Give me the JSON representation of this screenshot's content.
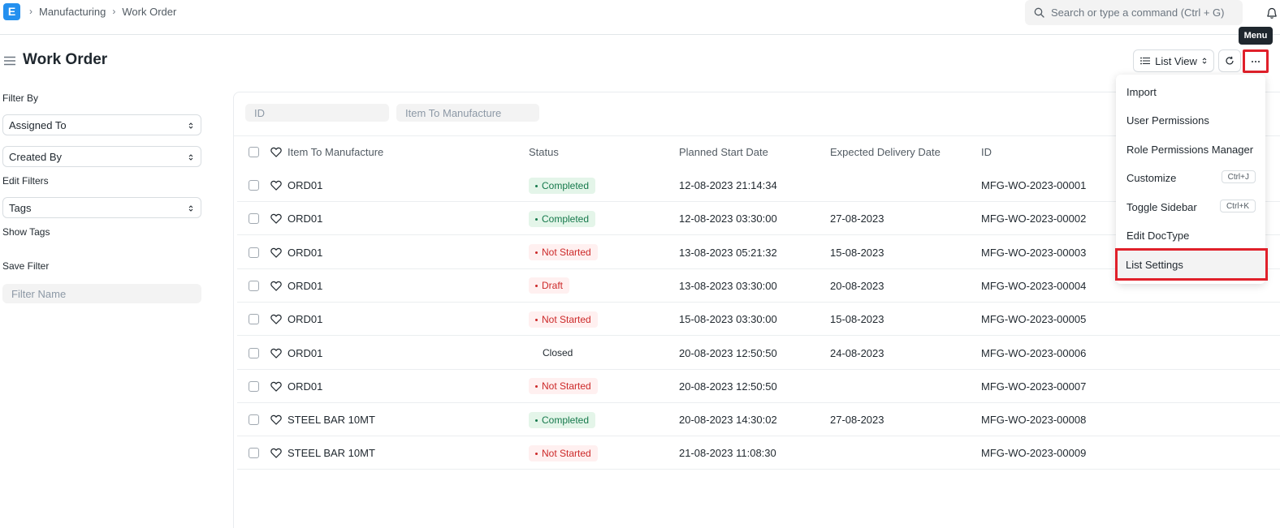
{
  "navbar": {
    "logo_letter": "E",
    "breadcrumbs": [
      "Manufacturing",
      "Work Order"
    ],
    "search_placeholder": "Search or type a command (Ctrl + G)"
  },
  "page": {
    "title": "Work Order",
    "list_view_label": "List View",
    "menu_tooltip": "Menu"
  },
  "sidebar": {
    "filter_by_label": "Filter By",
    "assigned_to": "Assigned To",
    "created_by": "Created By",
    "edit_filters": "Edit Filters",
    "tags": "Tags",
    "show_tags": "Show Tags",
    "save_filter_label": "Save Filter",
    "filter_name_placeholder": "Filter Name"
  },
  "filters": {
    "id_placeholder": "ID",
    "item_placeholder": "Item To Manufacture"
  },
  "table": {
    "headers": {
      "item": "Item To Manufacture",
      "status": "Status",
      "start": "Planned Start Date",
      "delivery": "Expected Delivery Date",
      "id": "ID"
    },
    "rows": [
      {
        "item": "ORD01",
        "status": "Completed",
        "start": "12-08-2023 21:14:34",
        "delivery": "",
        "id": "MFG-WO-2023-00001"
      },
      {
        "item": "ORD01",
        "status": "Completed",
        "start": "12-08-2023 03:30:00",
        "delivery": "27-08-2023",
        "id": "MFG-WO-2023-00002"
      },
      {
        "item": "ORD01",
        "status": "Not Started",
        "start": "13-08-2023 05:21:32",
        "delivery": "15-08-2023",
        "id": "MFG-WO-2023-00003"
      },
      {
        "item": "ORD01",
        "status": "Draft",
        "start": "13-08-2023 03:30:00",
        "delivery": "20-08-2023",
        "id": "MFG-WO-2023-00004"
      },
      {
        "item": "ORD01",
        "status": "Not Started",
        "start": "15-08-2023 03:30:00",
        "delivery": "15-08-2023",
        "id": "MFG-WO-2023-00005"
      },
      {
        "item": "ORD01",
        "status": "Closed",
        "start": "20-08-2023 12:50:50",
        "delivery": "24-08-2023",
        "id": "MFG-WO-2023-00006"
      },
      {
        "item": "ORD01",
        "status": "Not Started",
        "start": "20-08-2023 12:50:50",
        "delivery": "",
        "id": "MFG-WO-2023-00007"
      },
      {
        "item": "STEEL BAR 10MT",
        "status": "Completed",
        "start": "20-08-2023 14:30:02",
        "delivery": "27-08-2023",
        "id": "MFG-WO-2023-00008"
      },
      {
        "item": "STEEL BAR 10MT",
        "status": "Not Started",
        "start": "21-08-2023 11:08:30",
        "delivery": "",
        "id": "MFG-WO-2023-00009"
      }
    ]
  },
  "menu": {
    "items": [
      {
        "label": "Import",
        "shortcut": ""
      },
      {
        "label": "User Permissions",
        "shortcut": ""
      },
      {
        "label": "Role Permissions Manager",
        "shortcut": ""
      },
      {
        "label": "Customize",
        "shortcut": "Ctrl+J"
      },
      {
        "label": "Toggle Sidebar",
        "shortcut": "Ctrl+K"
      },
      {
        "label": "Edit DocType",
        "shortcut": ""
      },
      {
        "label": "List Settings",
        "shortcut": ""
      }
    ]
  },
  "colors": {
    "brand": "#2490ef",
    "highlight": "#e0202a",
    "completed": "#16794c",
    "not_started": "#cc2929"
  }
}
